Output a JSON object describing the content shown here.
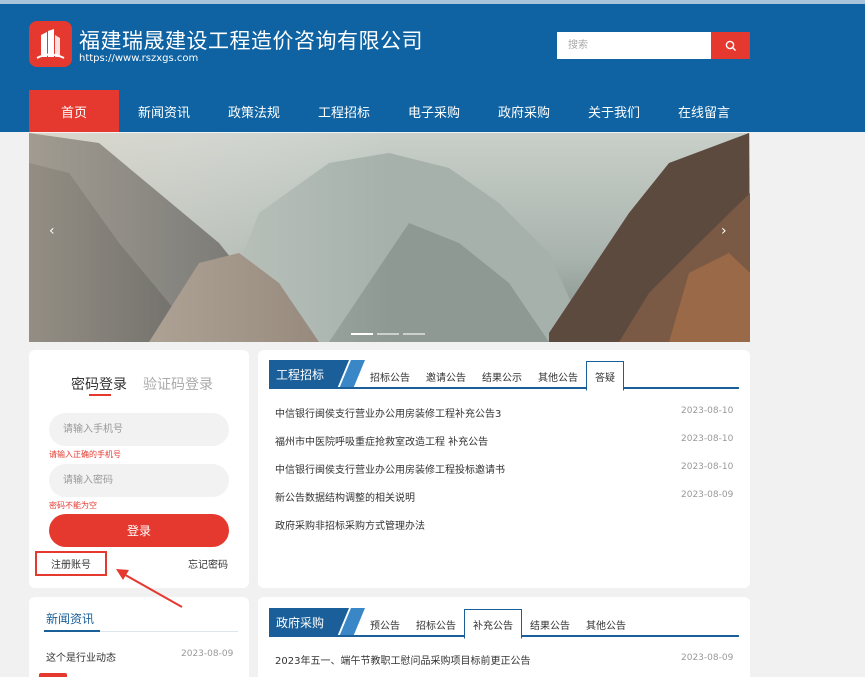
{
  "site": {
    "title": "福建瑞晟建设工程造价咨询有限公司",
    "url": "https://www.rszxgs.com",
    "search_placeholder": "搜索"
  },
  "nav": [
    {
      "label": "首页",
      "active": true
    },
    {
      "label": "新闻资讯"
    },
    {
      "label": "政策法规"
    },
    {
      "label": "工程招标"
    },
    {
      "label": "电子采购"
    },
    {
      "label": "政府采购"
    },
    {
      "label": "关于我们"
    },
    {
      "label": "在线留言"
    }
  ],
  "banner": {
    "prev_glyph": "‹",
    "next_glyph": "›",
    "slide_count": 3,
    "active_slide": 1
  },
  "login": {
    "tab_password": "密码登录",
    "tab_code": "验证码登录",
    "phone_placeholder": "请输入手机号",
    "phone_error": "请输入正确的手机号",
    "password_placeholder": "请输入密码",
    "password_error": "密码不能为空",
    "submit_label": "登录",
    "register_label": "注册账号",
    "forgot_label": "忘记密码"
  },
  "news": {
    "title": "新闻资讯",
    "items": [
      {
        "title": "这个是行业动态",
        "date": "2023-08-09"
      }
    ]
  },
  "tender": {
    "label": "工程招标",
    "tabs": [
      "招标公告",
      "邀请公告",
      "结果公示",
      "其他公告",
      "答疑"
    ],
    "active_tab": 4,
    "rows": [
      {
        "title": "中信银行闽侯支行营业办公用房装修工程补充公告3",
        "date": "2023-08-10"
      },
      {
        "title": "福州市中医院呼吸重症抢救室改造工程 补充公告",
        "date": "2023-08-10"
      },
      {
        "title": "中信银行闽侯支行营业办公用房装修工程投标邀请书",
        "date": "2023-08-10"
      },
      {
        "title": "新公告数据结构调整的相关说明",
        "date": "2023-08-09"
      },
      {
        "title": "政府采购非招标采购方式管理办法",
        "date": ""
      }
    ]
  },
  "gov": {
    "label": "政府采购",
    "tabs": [
      "预公告",
      "招标公告",
      "补充公告",
      "结果公告",
      "其他公告"
    ],
    "active_tab": 2,
    "rows": [
      {
        "title": "2023年五一、端午节教职工慰问品采购项目标前更正公告",
        "date": "2023-08-09"
      }
    ]
  },
  "colors": {
    "header_blue": "#0f63a2",
    "accent_red": "#e53930",
    "section_blue": "#1a5f99"
  }
}
